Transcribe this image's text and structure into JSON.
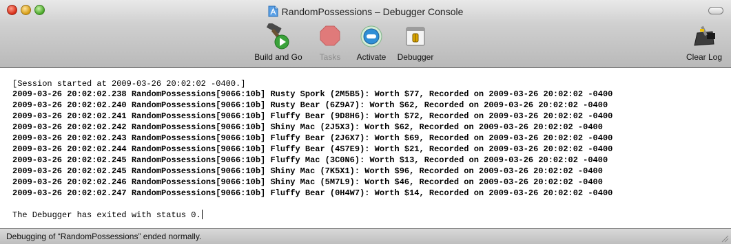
{
  "window": {
    "title": "RandomPossessions – Debugger Console"
  },
  "toolbar": {
    "build_and_go_label": "Build and Go",
    "tasks_label": "Tasks",
    "activate_label": "Activate",
    "debugger_label": "Debugger",
    "clear_log_label": "Clear Log"
  },
  "console": {
    "session_line": "[Session started at 2009-03-26 20:02:02 -0400.]",
    "log_lines": [
      "2009-03-26 20:02:02.238 RandomPossessions[9066:10b] Rusty Spork (2M5B5): Worth $77, Recorded on 2009-03-26 20:02:02 -0400",
      "2009-03-26 20:02:02.240 RandomPossessions[9066:10b] Rusty Bear (6Z9A7): Worth $62, Recorded on 2009-03-26 20:02:02 -0400",
      "2009-03-26 20:02:02.241 RandomPossessions[9066:10b] Fluffy Bear (9D8H6): Worth $72, Recorded on 2009-03-26 20:02:02 -0400",
      "2009-03-26 20:02:02.242 RandomPossessions[9066:10b] Shiny Mac (2J5X3): Worth $62, Recorded on 2009-03-26 20:02:02 -0400",
      "2009-03-26 20:02:02.243 RandomPossessions[9066:10b] Fluffy Bear (2J6X7): Worth $69, Recorded on 2009-03-26 20:02:02 -0400",
      "2009-03-26 20:02:02.244 RandomPossessions[9066:10b] Fluffy Bear (4S7E9): Worth $21, Recorded on 2009-03-26 20:02:02 -0400",
      "2009-03-26 20:02:02.245 RandomPossessions[9066:10b] Fluffy Mac (3C0N6): Worth $13, Recorded on 2009-03-26 20:02:02 -0400",
      "2009-03-26 20:02:02.245 RandomPossessions[9066:10b] Shiny Mac (7K5X1): Worth $96, Recorded on 2009-03-26 20:02:02 -0400",
      "2009-03-26 20:02:02.246 RandomPossessions[9066:10b] Shiny Mac (5M7L9): Worth $46, Recorded on 2009-03-26 20:02:02 -0400",
      "2009-03-26 20:02:02.247 RandomPossessions[9066:10b] Fluffy Bear (0H4W7): Worth $14, Recorded on 2009-03-26 20:02:02 -0400"
    ],
    "exit_line": "The Debugger has exited with status 0."
  },
  "status": {
    "text": "Debugging of “RandomPossessions” ended normally."
  },
  "icons": {
    "build_and_go": "hammer-play-icon",
    "tasks": "stop-sign-icon",
    "activate": "activate-icon",
    "debugger": "debugger-icon",
    "clear_log": "clear-log-icon",
    "title_document": "xcode-project-icon"
  },
  "colors": {
    "close": "#d42a14",
    "minimize": "#d49a10",
    "zoom": "#46a526",
    "tasks_stop": "#e07a7a",
    "activate_blue": "#2f8fd6"
  }
}
